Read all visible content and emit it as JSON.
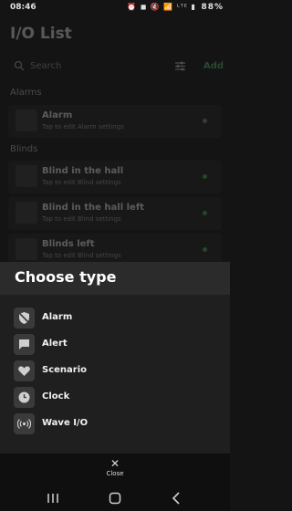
{
  "status": {
    "time": "08:46",
    "icons": "⏰ ◼ 🔇 📶 ᴸᵀᴱ ▮",
    "battery": "88%"
  },
  "page": {
    "title": "I/O List"
  },
  "search": {
    "placeholder": "Search",
    "add_label": "Add"
  },
  "sections": {
    "alarms": "Alarms",
    "blinds": "Blinds"
  },
  "items": [
    {
      "name": "Alarm",
      "subtitle": "Tap to edit Alarm settings",
      "status_color": "#8a8a8a"
    },
    {
      "name": "Blind in the hall",
      "subtitle": "Tap to edit Blind settings",
      "status_color": "#4caf50"
    },
    {
      "name": "Blind in the hall left",
      "subtitle": "Tap to edit Blind settings",
      "status_color": "#4caf50"
    },
    {
      "name": "Blinds left",
      "subtitle": "Tap to edit Blind settings",
      "status_color": "#4caf50"
    }
  ],
  "sheet": {
    "title": "Choose type",
    "options": [
      {
        "label": "Alarm",
        "icon": "shield-off-icon"
      },
      {
        "label": "Alert",
        "icon": "chat-bubble-icon"
      },
      {
        "label": "Scenario",
        "icon": "heart-icon"
      },
      {
        "label": "Clock",
        "icon": "clock-icon"
      },
      {
        "label": "Wave I/O",
        "icon": "wave-broadcast-icon"
      }
    ],
    "close_label": "Close"
  },
  "colors": {
    "accent": "#58b66a",
    "status_active": "#4caf50",
    "status_inactive": "#8a8a8a"
  }
}
